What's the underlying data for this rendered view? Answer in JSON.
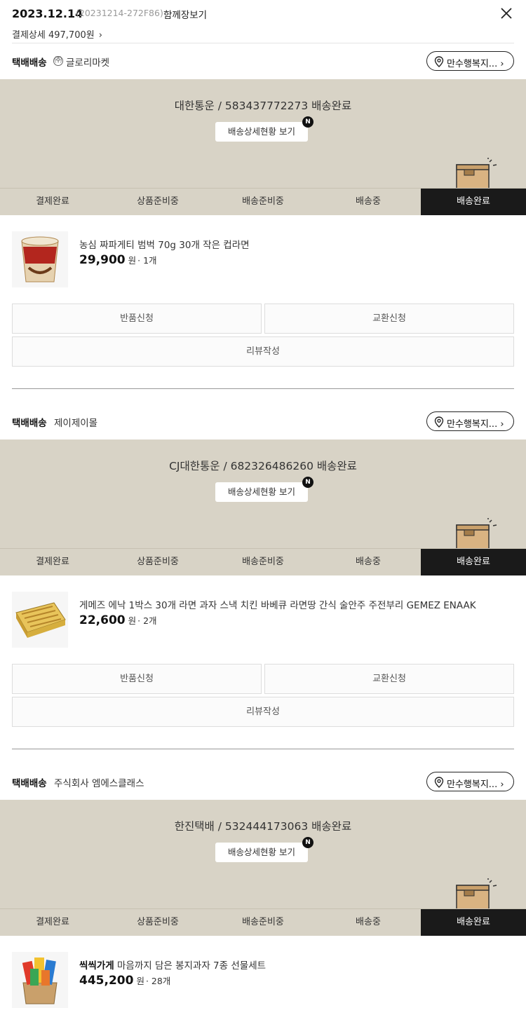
{
  "header": {
    "date": "2023.12.14",
    "order_code": "(20231214-272F86)",
    "together_label": "함께장보기",
    "payment_label": "결제상세 497,700원"
  },
  "steps": [
    "결제완료",
    "상품준비중",
    "배송준비중",
    "배송중",
    "배송완료"
  ],
  "track_label": "배송상세현황 보기",
  "new_badge": "N",
  "shipments": [
    {
      "type": "택배배송",
      "badge": "㈜",
      "seller": "글로리마켓",
      "address": "만수행복지...",
      "carrier_status": "대한통운 / 583437772273 배송완료",
      "product": {
        "brand": "",
        "name": "농심 짜파게티 범벅 70g 30개 작은 컵라면",
        "price": "29,900",
        "unit": "원",
        "qty": "· 1개"
      },
      "actions": {
        "return": "반품신청",
        "exchange": "교환신청",
        "review": "리뷰작성"
      }
    },
    {
      "type": "택배배송",
      "seller": "제이제이몰",
      "address": "만수행복지...",
      "carrier_status": "CJ대한통운 / 682326486260 배송완료",
      "product": {
        "brand": "",
        "name": "게메즈 에낙 1박스 30개 라면 과자 스낵 치킨 바베큐 라면땅 간식 술안주 주전부리 GEMEZ ENAAK",
        "price": "22,600",
        "unit": "원",
        "qty": "· 2개"
      },
      "actions": {
        "return": "반품신청",
        "exchange": "교환신청",
        "review": "리뷰작성"
      }
    },
    {
      "type": "택배배송",
      "seller": "주식회사 엠에스클래스",
      "address": "만수행복지...",
      "carrier_status": "한진택배 / 532444173063 배송완료",
      "product": {
        "brand": "씩씩가게",
        "name": "마음까지 담은 봉지과자 7종 선물세트",
        "price": "445,200",
        "unit": "원",
        "qty": "· 28개"
      }
    }
  ],
  "colors": {
    "ship_bg": "#d8d3c6",
    "active_step": "#1a1a1a",
    "box": "#d9b382"
  }
}
